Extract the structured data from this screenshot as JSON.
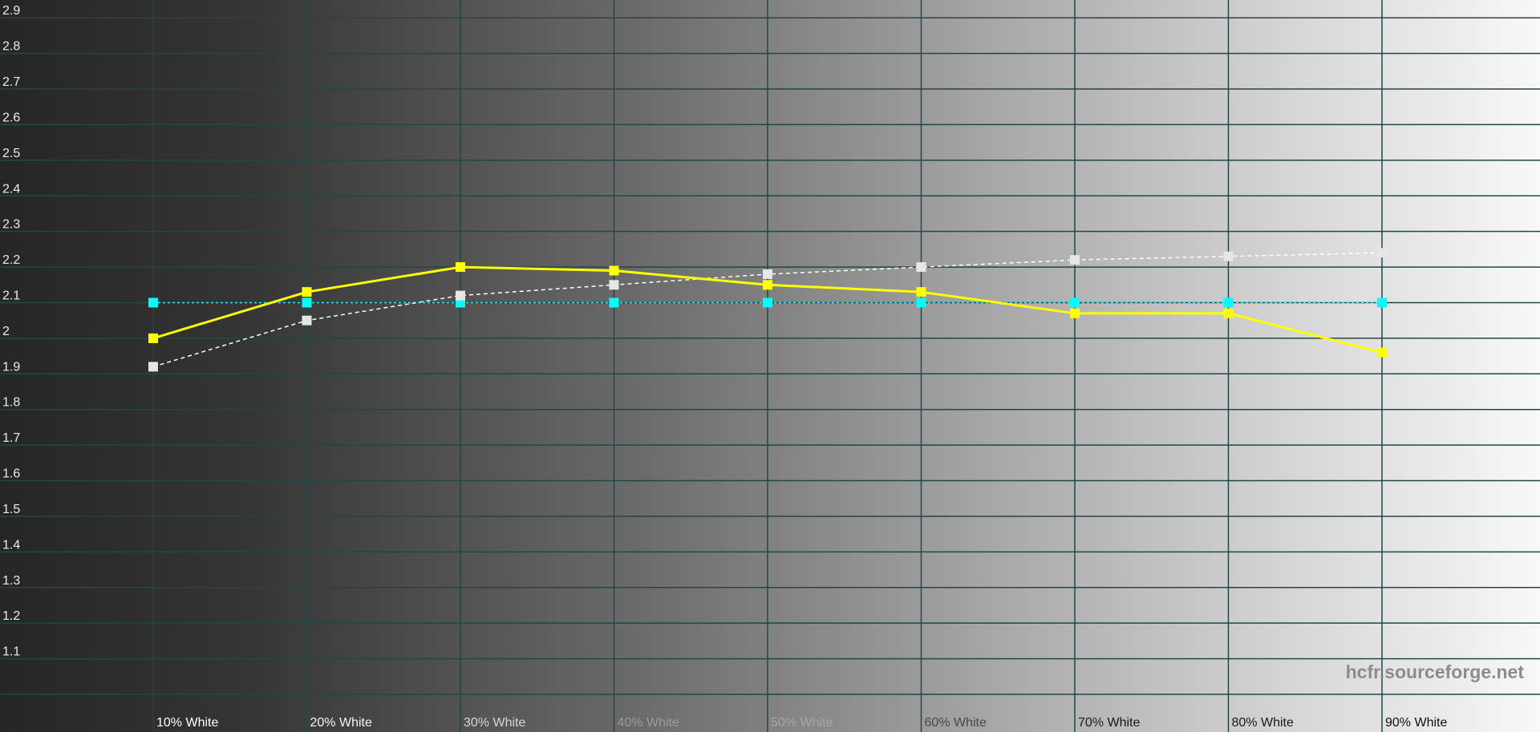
{
  "chart_data": {
    "type": "line",
    "title": "",
    "xlabel": "",
    "ylabel": "",
    "categories": [
      "10% White",
      "20% White",
      "30% White",
      "40% White",
      "50% White",
      "60% White",
      "70% White",
      "80% White",
      "90% White"
    ],
    "y_ticks": [
      "2.9",
      "2.8",
      "2.7",
      "2.6",
      "2.5",
      "2.4",
      "2.3",
      "2.2",
      "2.1",
      "2",
      "1.9",
      "1.8",
      "1.7",
      "1.6",
      "1.5",
      "1.4",
      "1.3",
      "1.2",
      "1.1"
    ],
    "ylim": [
      1.0,
      2.95
    ],
    "grid": true,
    "legend": "none",
    "background": "black-to-white gradient",
    "watermark": "hcfr.sourceforge.net",
    "series": [
      {
        "color": "#ffff00",
        "line_style": "solid",
        "values": [
          2.0,
          2.13,
          2.2,
          2.19,
          2.15,
          2.13,
          2.07,
          2.07,
          1.96
        ]
      },
      {
        "color": "#ffffff",
        "line_style": "dashed",
        "values": [
          1.92,
          2.05,
          2.12,
          2.15,
          2.18,
          2.2,
          2.22,
          2.23,
          2.24
        ]
      },
      {
        "color": "#00ffff",
        "line_style": "dotted",
        "values": [
          2.1,
          2.1,
          2.1,
          2.1,
          2.1,
          2.1,
          2.1,
          2.1,
          2.1
        ]
      }
    ]
  }
}
